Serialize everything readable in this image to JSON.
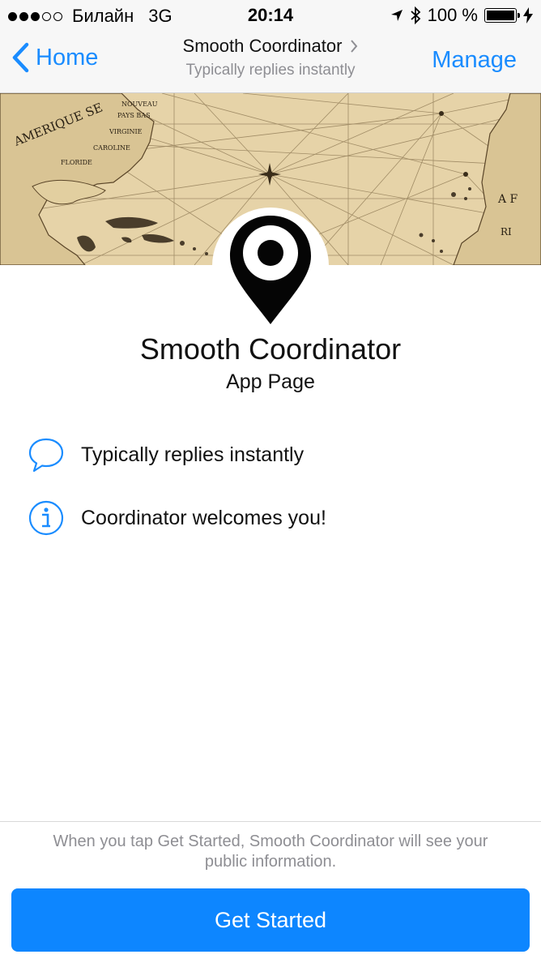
{
  "status_bar": {
    "carrier": "Билайн",
    "network": "3G",
    "time": "20:14",
    "battery": "100 %",
    "battery_level": 1.0
  },
  "nav": {
    "back_label": "Home",
    "title": "Smooth Coordinator",
    "subtitle": "Typically replies instantly",
    "manage_label": "Manage",
    "accent_color": "#1a8cff"
  },
  "cover": {
    "icon": "antique-map-image",
    "map_labels": [
      "AMERIQUE SE",
      "NOUVEAU",
      "PAYS BAS",
      "VIRGINIE",
      "CAROLINE",
      "FLORIDE",
      "A F",
      "RI"
    ]
  },
  "profile": {
    "icon": "location-pin-icon",
    "name": "Smooth Coordinator",
    "type": "App Page"
  },
  "info": [
    {
      "icon": "speech-bubble-icon",
      "text": "Typically replies instantly"
    },
    {
      "icon": "info-icon",
      "text": "Coordinator welcomes you!"
    }
  ],
  "footer": {
    "notice": "When you tap Get Started, Smooth Coordinator will see your public information.",
    "cta_label": "Get Started",
    "cta_color": "#0d86ff"
  }
}
